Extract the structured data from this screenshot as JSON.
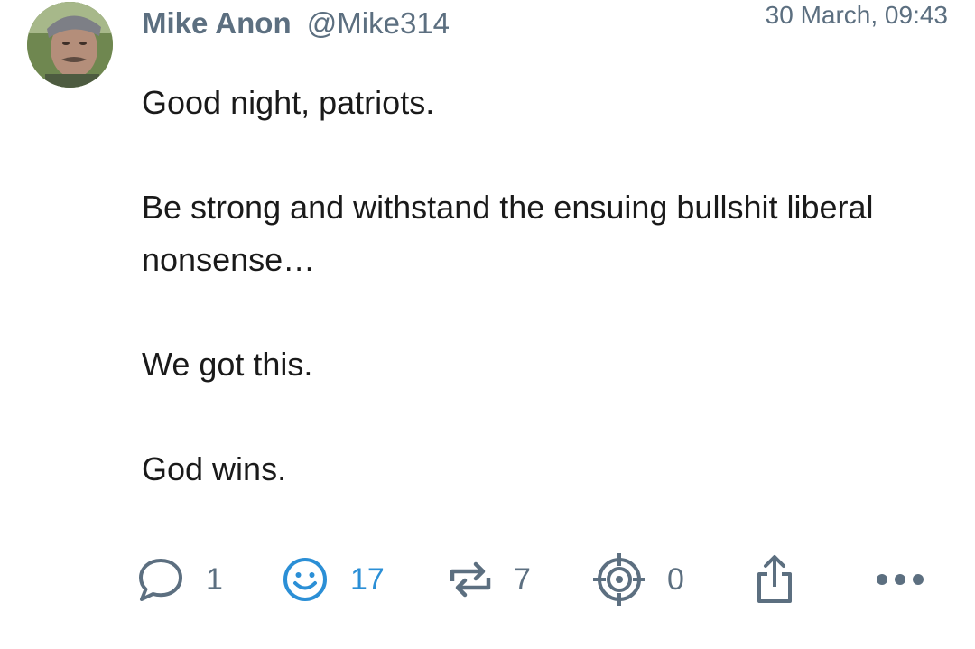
{
  "post": {
    "author": {
      "name": "Mike Anon",
      "handle": "@Mike314"
    },
    "timestamp": "30 March, 09:43",
    "paragraphs": [
      "Good night, patriots.",
      "Be strong and withstand the ensuing bullshit liberal nonsense…",
      "We got this.",
      "God wins."
    ],
    "actions": {
      "replies": {
        "icon": "comment-icon",
        "count": "1"
      },
      "reactions": {
        "icon": "smiley-icon",
        "count": "17",
        "color": "#2b8fd6"
      },
      "reposts": {
        "icon": "repost-icon",
        "count": "7"
      },
      "targets": {
        "icon": "crosshair-icon",
        "count": "0"
      },
      "share": {
        "icon": "share-icon"
      },
      "more": {
        "icon": "more-icon"
      }
    }
  },
  "colors": {
    "meta_text": "#5c6f80",
    "body_text": "#1a1a1a",
    "accent": "#2b8fd6"
  }
}
